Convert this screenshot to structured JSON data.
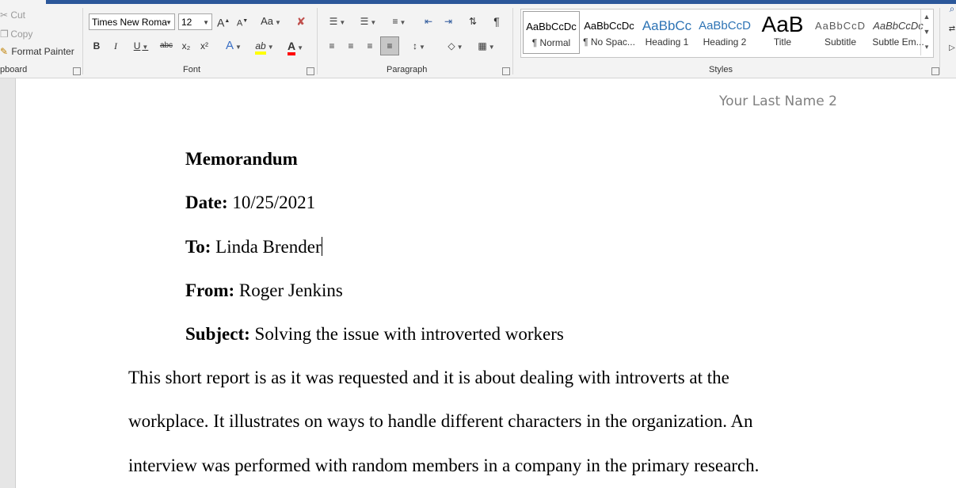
{
  "clipboard": {
    "cut_label": "Cut",
    "copy_label": "Copy",
    "format_painter_label": "Format Painter",
    "group_label": "pboard"
  },
  "font": {
    "name": "Times New Roma",
    "size": "12",
    "group_label": "Font",
    "case_label": "Aa",
    "grow_label": "A",
    "shrink_label": "A",
    "bold": "B",
    "italic": "I",
    "underline": "U",
    "strike": "abc",
    "subscript": "x₂",
    "superscript": "x²",
    "effects": "A",
    "highlight": "ab",
    "color": "A",
    "highlight_color": "#ffff00",
    "font_color": "#ff0000"
  },
  "paragraph": {
    "group_label": "Paragraph"
  },
  "styles": {
    "group_label": "Styles",
    "items": [
      {
        "preview": "AaBbCcDc",
        "name": "¶ Normal"
      },
      {
        "preview": "AaBbCcDc",
        "name": "¶ No Spac..."
      },
      {
        "preview": "AaBbCc",
        "name": "Heading 1"
      },
      {
        "preview": "AaBbCcD",
        "name": "Heading 2"
      },
      {
        "preview": "AaB",
        "name": "Title"
      },
      {
        "preview": "AaBbCcD",
        "name": "Subtitle"
      },
      {
        "preview": "AaBbCcDc",
        "name": "Subtle Em..."
      }
    ]
  },
  "document": {
    "header": "Your Last Name 2",
    "title": "Memorandum",
    "date_label": "Date:",
    "date_value": " 10/25/2021",
    "to_label": "To:",
    "to_value": " Linda Brender",
    "from_label": "From:",
    "from_value": " Roger Jenkins",
    "subject_label": "Subject:",
    "subject_value": " Solving the issue with introverted workers",
    "body_lines": [
      "This short report is as it was requested and it is about dealing with introverts at the",
      "workplace. It illustrates on ways to handle different characters in the organization. An",
      "interview was performed with random members in a company in the primary research."
    ]
  },
  "colors": {
    "accent": "#2b579a",
    "heading_blue": "#2e74b5"
  }
}
